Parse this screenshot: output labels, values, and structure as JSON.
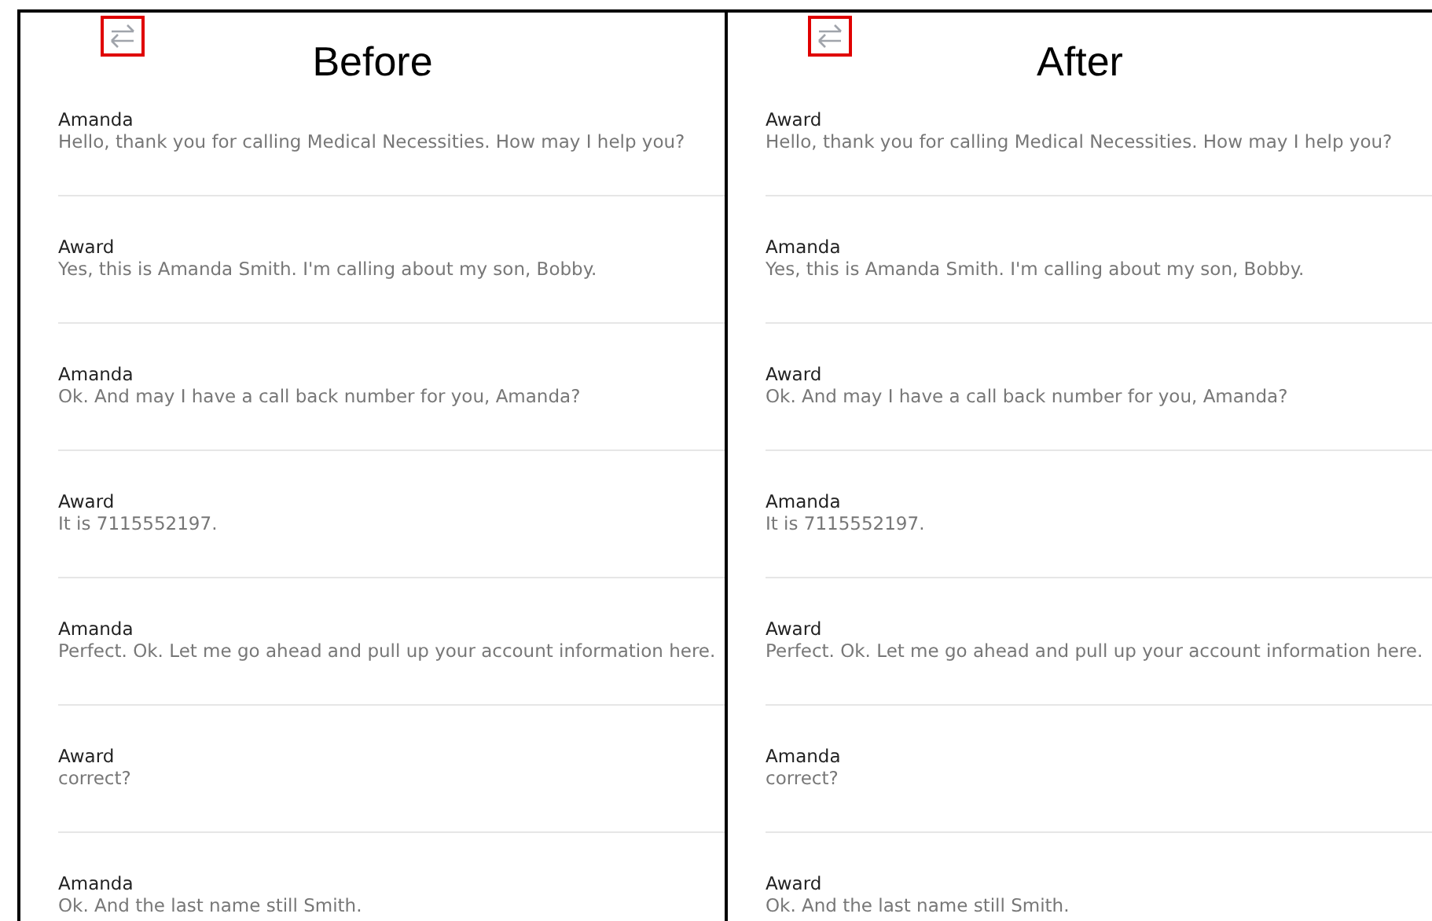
{
  "panels": [
    {
      "title": "Before",
      "swap_highlighted": true,
      "entries": [
        {
          "speaker": "Amanda",
          "text": "Hello, thank you for calling Medical Necessities. How may I help you?"
        },
        {
          "speaker": "Award",
          "text": "Yes, this is Amanda Smith. I'm calling about my son, Bobby."
        },
        {
          "speaker": "Amanda",
          "text": "Ok. And may I have a call back number for you, Amanda?"
        },
        {
          "speaker": "Award",
          "text": "It is 7115552197."
        },
        {
          "speaker": "Amanda",
          "text": "Perfect. Ok. Let me go ahead and pull up your account information here."
        },
        {
          "speaker": "Award",
          "text": "correct?"
        },
        {
          "speaker": "Amanda",
          "text": "Ok. And the last name still Smith."
        }
      ]
    },
    {
      "title": "After",
      "swap_highlighted": true,
      "entries": [
        {
          "speaker": "Award",
          "text": "Hello, thank you for calling Medical Necessities. How may I help you?"
        },
        {
          "speaker": "Amanda",
          "text": "Yes, this is Amanda Smith. I'm calling about my son, Bobby."
        },
        {
          "speaker": "Award",
          "text": "Ok. And may I have a call back number for you, Amanda?"
        },
        {
          "speaker": "Amanda",
          "text": "It is 7115552197."
        },
        {
          "speaker": "Award",
          "text": "Perfect. Ok. Let me go ahead and pull up your account information here."
        },
        {
          "speaker": "Amanda",
          "text": "correct?"
        },
        {
          "speaker": "Award",
          "text": "Ok. And the last name still Smith."
        }
      ]
    }
  ]
}
